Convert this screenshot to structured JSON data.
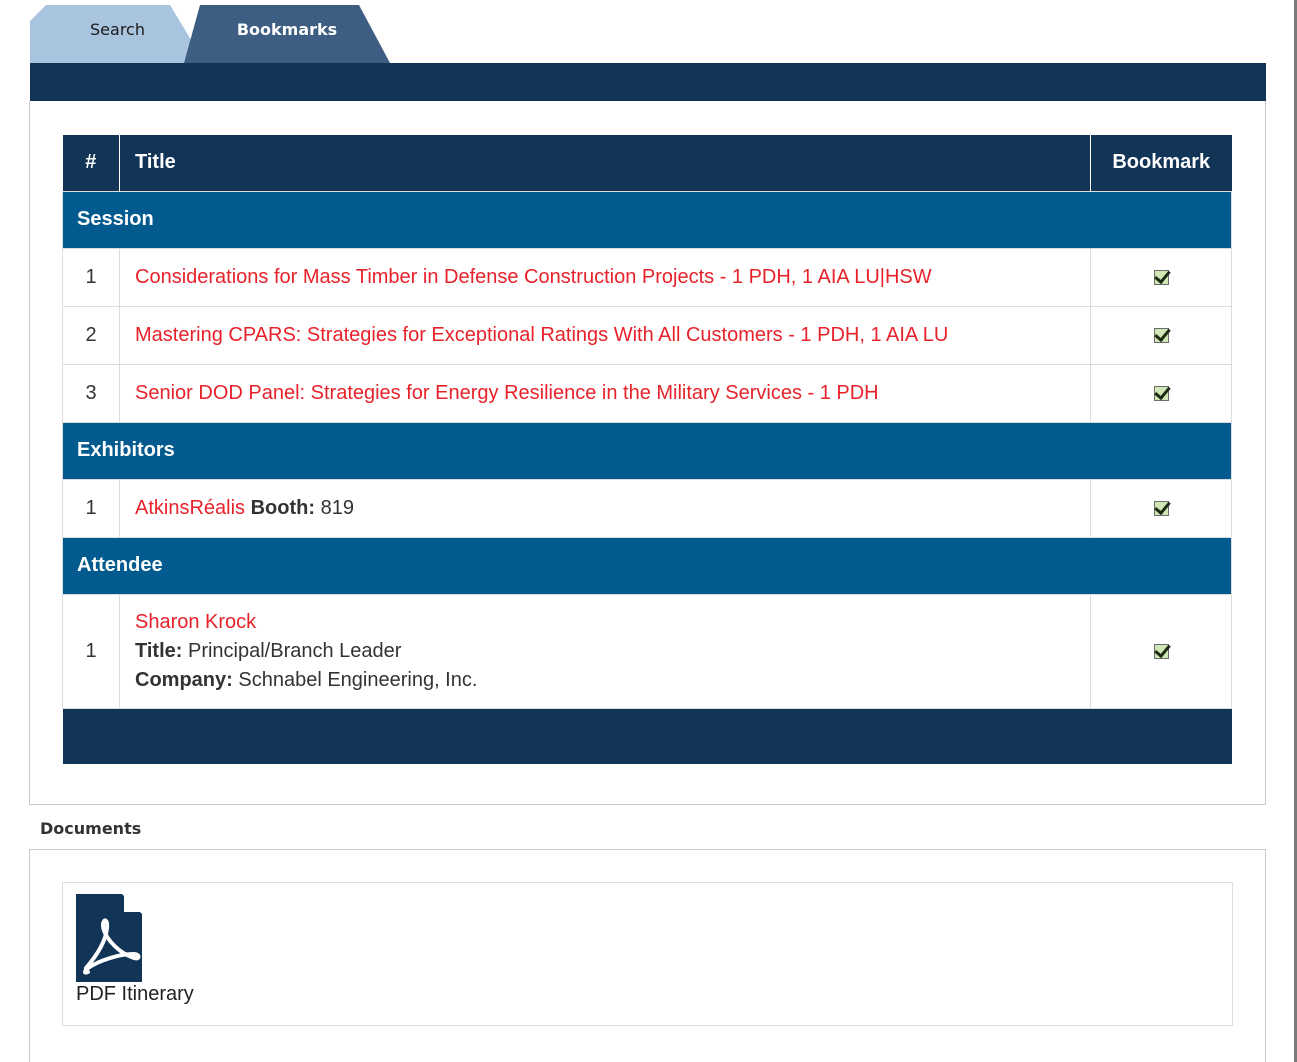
{
  "tabs": {
    "search": "Search",
    "bookmarks": "Bookmarks"
  },
  "table": {
    "headers": {
      "num": "#",
      "title": "Title",
      "bookmark": "Bookmark"
    },
    "groups": {
      "session": {
        "label": "Session",
        "items": [
          {
            "num": "1",
            "title": "Considerations for Mass Timber in Defense Construction Projects - 1 PDH, 1 AIA LU|HSW",
            "bookmarked": true
          },
          {
            "num": "2",
            "title": "Mastering CPARS: Strategies for Exceptional Ratings With All Customers - 1 PDH, 1 AIA LU",
            "bookmarked": true
          },
          {
            "num": "3",
            "title": "Senior DOD Panel: Strategies for Energy Resilience in the Military Services - 1 PDH",
            "bookmarked": true
          }
        ]
      },
      "exhibitors": {
        "label": "Exhibitors",
        "items": [
          {
            "num": "1",
            "name": "AtkinsRéalis",
            "booth_label": "Booth:",
            "booth": "819",
            "bookmarked": true
          }
        ]
      },
      "attendee": {
        "label": "Attendee",
        "items": [
          {
            "num": "1",
            "name": "Sharon Krock",
            "title_label": "Title:",
            "title": "Principal/Branch Leader",
            "company_label": "Company:",
            "company": "Schnabel Engineering, Inc.",
            "bookmarked": true
          }
        ]
      }
    }
  },
  "documents": {
    "heading": "Documents",
    "items": [
      {
        "label": "PDF Itinerary",
        "icon": "pdf-file-icon"
      }
    ]
  },
  "colors": {
    "navy": "#123457",
    "group_blue": "#035a8f",
    "link_red": "#e8222a",
    "tab_active": "#3d5d82",
    "tab_inactive": "#a9c4de"
  }
}
